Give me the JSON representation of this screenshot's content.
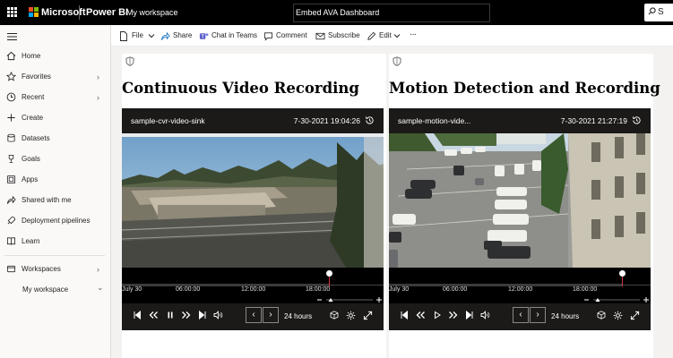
{
  "app": {
    "brand": "Microsoft",
    "product": "Power BI",
    "workspace": "My workspace",
    "report_title": "Embed AVA Dashboard",
    "search_label": "S"
  },
  "sidebar": {
    "items": [
      {
        "label": "Home",
        "icon": "home-icon",
        "chevron": ""
      },
      {
        "label": "Favorites",
        "icon": "star-icon",
        "chevron": "›"
      },
      {
        "label": "Recent",
        "icon": "clock-icon",
        "chevron": "›"
      },
      {
        "label": "Create",
        "icon": "plus-icon",
        "chevron": ""
      },
      {
        "label": "Datasets",
        "icon": "database-icon",
        "chevron": ""
      },
      {
        "label": "Goals",
        "icon": "trophy-icon",
        "chevron": ""
      },
      {
        "label": "Apps",
        "icon": "apps-icon",
        "chevron": ""
      },
      {
        "label": "Shared with me",
        "icon": "share-icon",
        "chevron": ""
      },
      {
        "label": "Deployment pipelines",
        "icon": "rocket-icon",
        "chevron": ""
      },
      {
        "label": "Learn",
        "icon": "book-icon",
        "chevron": ""
      }
    ],
    "workspaces": {
      "label": "Workspaces",
      "chevron": "›"
    },
    "my_workspace": {
      "label": "My workspace",
      "chevron": "⌄"
    }
  },
  "actionbar": {
    "file": "File",
    "share": "Share",
    "chat": "Chat in Teams",
    "comment": "Comment",
    "subscribe": "Subscribe",
    "edit": "Edit",
    "more": "···"
  },
  "panels": [
    {
      "title": "Continuous Video Recording",
      "stream_name": "sample-cvr-video-sink",
      "timestamp": "7-30-2021 19:04:26",
      "timeline_labels": [
        "July 30",
        "06:00:00",
        "12:00:00",
        "18:00:00"
      ],
      "playhead_position": 0.79,
      "range": "24 hours",
      "play_state_icon": "pause-icon"
    },
    {
      "title": "Motion Detection and Recording",
      "stream_name": "sample-motion-vide...",
      "timestamp": "7-30-2021 21:27:19",
      "timeline_labels": [
        "July 30",
        "06:00:00",
        "12:00:00",
        "18:00:00"
      ],
      "playhead_position": 0.89,
      "range": "24 hours",
      "play_state_icon": "play-icon"
    }
  ],
  "colors": {
    "topbar": "#000000",
    "ms_red": "#f25022",
    "ms_green": "#7fba00",
    "ms_blue": "#00a4ef",
    "ms_yellow": "#ffb900",
    "playhead": "#d13438"
  }
}
